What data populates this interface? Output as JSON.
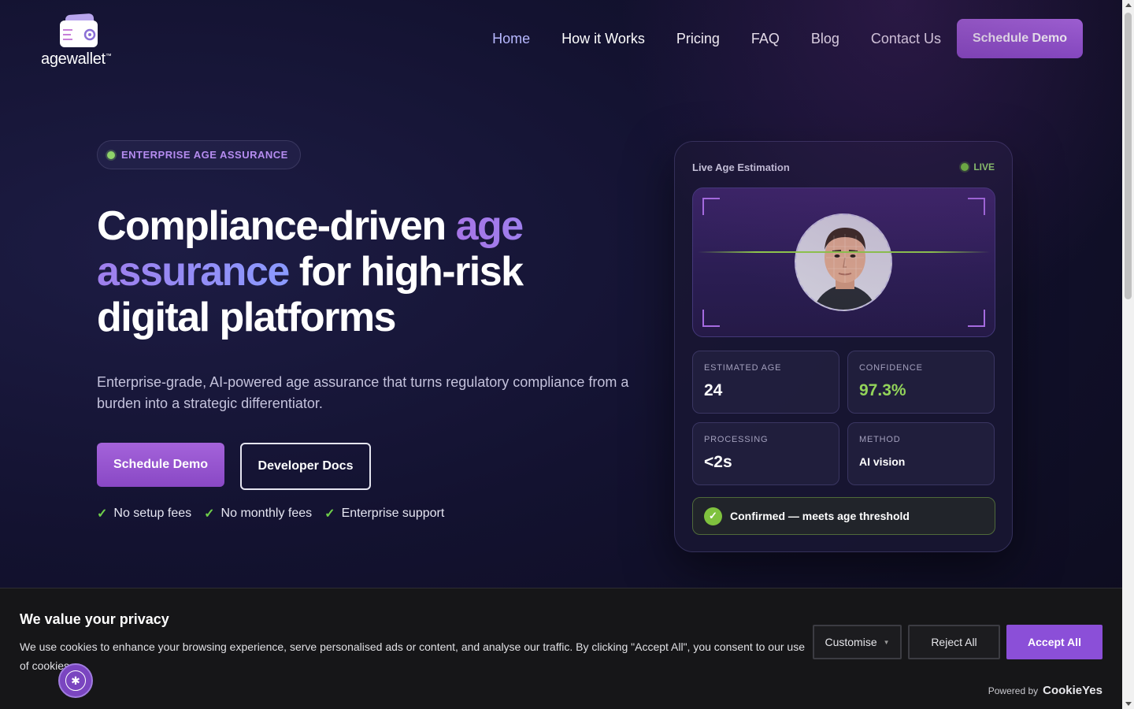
{
  "brand": {
    "name": "agewallet",
    "trademark": "™",
    "accent_color": "#9b5ad6",
    "success_color": "#7fc23e"
  },
  "nav": {
    "items": [
      {
        "label": "Home",
        "active": true
      },
      {
        "label": "How it Works"
      },
      {
        "label": "Pricing"
      },
      {
        "label": "FAQ"
      },
      {
        "label": "Blog"
      },
      {
        "label": "Contact Us"
      }
    ],
    "cta_label": "Schedule Demo"
  },
  "hero": {
    "badge": "ENTERPRISE AGE ASSURANCE",
    "headline_part1": "Compliance-driven ",
    "headline_highlight": "age assurance",
    "headline_part2": " for high-risk digital platforms",
    "subhead": "Enterprise-grade, AI-powered age assurance that turns regulatory compliance from a burden into a strategic differentiator.",
    "primary_button": "Schedule Demo",
    "secondary_button": "Developer Docs",
    "features": [
      "No setup fees",
      "No monthly fees",
      "Enterprise support"
    ]
  },
  "card": {
    "title": "Live Age Estimation",
    "status": "LIVE",
    "stats": [
      {
        "label": "ESTIMATED AGE",
        "value": "24"
      },
      {
        "label": "CONFIDENCE",
        "value": "97.3%"
      },
      {
        "label": "PROCESSING",
        "value": "<2s"
      },
      {
        "label": "METHOD",
        "value": "AI vision"
      }
    ],
    "confirmation": "Confirmed — meets age threshold"
  },
  "cookie": {
    "title": "We value your privacy",
    "text": "We use cookies to enhance your browsing experience, serve personalised ads or content, and analyse our traffic. By clicking \"Accept All\", you consent to our use of cookies.",
    "customise_label": "Customise",
    "reject_label": "Reject All",
    "accept_label": "Accept All",
    "powered_by": "Powered by",
    "provider": "CookieYes"
  }
}
